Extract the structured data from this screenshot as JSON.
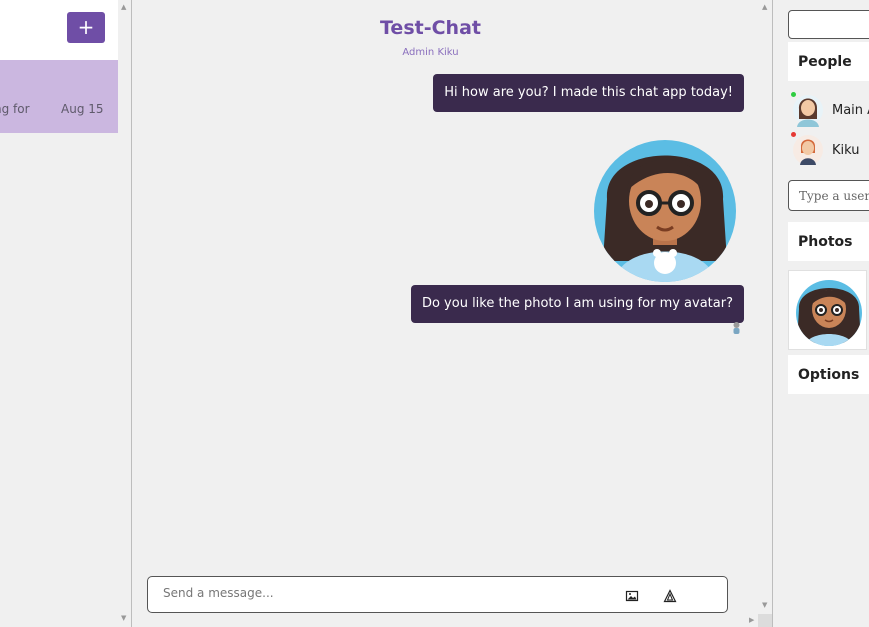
{
  "left": {
    "new_chat_label": "+",
    "chat_item": {
      "preview": "ng for",
      "date": "Aug 15"
    }
  },
  "chat": {
    "title": "Test-Chat",
    "subtitle": "Admin Kiku",
    "messages": [
      {
        "text": "Hi how are you? I made this chat app today!"
      },
      {
        "text": "Do you like the photo I am using for my avatar?"
      }
    ],
    "composer_placeholder": "Send a message..."
  },
  "right": {
    "sections": {
      "people": "People",
      "photos": "Photos",
      "options": "Options"
    },
    "people": [
      {
        "name": "Main A",
        "status_color": "#2ecc40"
      },
      {
        "name": "Kiku",
        "status_color": "#e53935"
      }
    ],
    "username_placeholder": "Type a usernam"
  },
  "colors": {
    "accent": "#6f4ea6",
    "bubble": "#3a2a4d",
    "selected_chat": "#cbb7e0"
  },
  "icons": {
    "new_chat": "plus-icon",
    "attach": "image-icon",
    "send": "send-triangle-icon",
    "seen": "seen-avatar-icon"
  }
}
